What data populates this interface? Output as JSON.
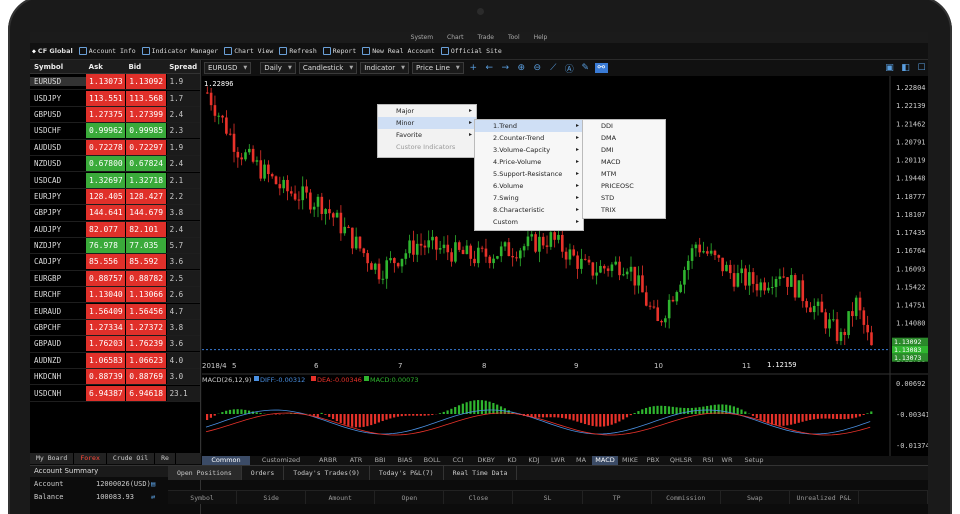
{
  "app": {
    "logo": "CF Global",
    "menu": [
      "System",
      "Chart",
      "Trade",
      "Tool",
      "Help"
    ]
  },
  "toolbar": [
    "Account Info",
    "Indicator Manager",
    "Chart View",
    "Refresh",
    "Report",
    "New Real Account",
    "Official Site"
  ],
  "watchlist": {
    "headers": [
      "Symbol",
      "Ask",
      "Bid",
      "Spread"
    ],
    "rows": [
      {
        "symbol": "EURUSD",
        "ask": "1.13073",
        "bid": "1.13092",
        "spread": "1.9",
        "ask_color": "#e0302a",
        "bid_color": "#e0302a"
      },
      {
        "symbol": "USDJPY",
        "ask": "113.551",
        "bid": "113.568",
        "spread": "1.7",
        "ask_color": "#e0302a",
        "bid_color": "#e0302a"
      },
      {
        "symbol": "GBPUSD",
        "ask": "1.27375",
        "bid": "1.27399",
        "spread": "2.4",
        "ask_color": "#e0302a",
        "bid_color": "#e0302a"
      },
      {
        "symbol": "USDCHF",
        "ask": "0.99962",
        "bid": "0.99985",
        "spread": "2.3",
        "ask_color": "#3aaa3a",
        "bid_color": "#3aaa3a"
      },
      {
        "symbol": "AUDUSD",
        "ask": "0.72278",
        "bid": "0.72297",
        "spread": "1.9",
        "ask_color": "#e0302a",
        "bid_color": "#e0302a"
      },
      {
        "symbol": "NZDUSD",
        "ask": "0.67800",
        "bid": "0.67824",
        "spread": "2.4",
        "ask_color": "#3aaa3a",
        "bid_color": "#3aaa3a"
      },
      {
        "symbol": "USDCAD",
        "ask": "1.32697",
        "bid": "1.32718",
        "spread": "2.1",
        "ask_color": "#3aaa3a",
        "bid_color": "#3aaa3a"
      },
      {
        "symbol": "EURJPY",
        "ask": "128.405",
        "bid": "128.427",
        "spread": "2.2",
        "ask_color": "#e0302a",
        "bid_color": "#e0302a"
      },
      {
        "symbol": "GBPJPY",
        "ask": "144.641",
        "bid": "144.679",
        "spread": "3.8",
        "ask_color": "#e0302a",
        "bid_color": "#e0302a"
      },
      {
        "symbol": "AUDJPY",
        "ask": "82.077",
        "bid": "82.101",
        "spread": "2.4",
        "ask_color": "#e0302a",
        "bid_color": "#e0302a"
      },
      {
        "symbol": "NZDJPY",
        "ask": "76.978",
        "bid": "77.035",
        "spread": "5.7",
        "ask_color": "#3aaa3a",
        "bid_color": "#3aaa3a"
      },
      {
        "symbol": "CADJPY",
        "ask": "85.556",
        "bid": "85.592",
        "spread": "3.6",
        "ask_color": "#e0302a",
        "bid_color": "#e0302a"
      },
      {
        "symbol": "EURGBP",
        "ask": "0.88757",
        "bid": "0.88782",
        "spread": "2.5",
        "ask_color": "#e0302a",
        "bid_color": "#e0302a"
      },
      {
        "symbol": "EURCHF",
        "ask": "1.13040",
        "bid": "1.13066",
        "spread": "2.6",
        "ask_color": "#e0302a",
        "bid_color": "#e0302a"
      },
      {
        "symbol": "EURAUD",
        "ask": "1.56409",
        "bid": "1.56456",
        "spread": "4.7",
        "ask_color": "#e0302a",
        "bid_color": "#e0302a"
      },
      {
        "symbol": "GBPCHF",
        "ask": "1.27334",
        "bid": "1.27372",
        "spread": "3.8",
        "ask_color": "#e0302a",
        "bid_color": "#e0302a"
      },
      {
        "symbol": "GBPAUD",
        "ask": "1.76203",
        "bid": "1.76239",
        "spread": "3.6",
        "ask_color": "#e0302a",
        "bid_color": "#e0302a"
      },
      {
        "symbol": "AUDNZD",
        "ask": "1.06583",
        "bid": "1.06623",
        "spread": "4.0",
        "ask_color": "#e0302a",
        "bid_color": "#e0302a"
      },
      {
        "symbol": "HKDCNH",
        "ask": "0.88739",
        "bid": "0.88769",
        "spread": "3.0",
        "ask_color": "#e0302a",
        "bid_color": "#e0302a"
      },
      {
        "symbol": "USDCNH",
        "ask": "6.94387",
        "bid": "6.94618",
        "spread": "23.1",
        "ask_color": "#e0302a",
        "bid_color": "#e0302a"
      }
    ],
    "tabs": [
      "My Board",
      "Forex",
      "Crude Oil",
      "Re"
    ]
  },
  "chart_toolbar": {
    "symbol": "EURUSD",
    "period": "Daily",
    "style": "Candlestick",
    "indicator": "Indicator",
    "line": "Price Line"
  },
  "menus": {
    "level1": [
      "Major",
      "Minor",
      "Favorite",
      "Custore Indicators"
    ],
    "level2": [
      "1.Trend",
      "2.Counter-Trend",
      "3.Volume-Capcity",
      "4.Price-Volume",
      "5.Support-Resistance",
      "6.Volume",
      "7.Swing",
      "8.Characteristic",
      "Custom"
    ],
    "level3": [
      "DDI",
      "DMA",
      "DMI",
      "MACD",
      "MTM",
      "PRICEOSC",
      "STD",
      "TRIX"
    ]
  },
  "chart_data": {
    "type": "candlestick",
    "symbol": "EURUSD",
    "ylim": [
      1.12738,
      1.22804
    ],
    "yticks": [
      "1.22804",
      "1.22139",
      "1.21462",
      "1.20791",
      "1.20119",
      "1.19448",
      "1.18777",
      "1.18107",
      "1.17435",
      "1.16764",
      "1.16093",
      "1.15422",
      "1.14751",
      "1.14080",
      "1.13409",
      "1.12738"
    ],
    "xticks": [
      "2018/4",
      "5",
      "6",
      "7",
      "8",
      "9",
      "10",
      "11"
    ],
    "labels": {
      "top": "1.22896",
      "low": "1.12159",
      "price1": "1.13092",
      "price2": "1.13083",
      "price3": "1.13073"
    },
    "macd": {
      "title": "MACD(26,12,9)",
      "diff": "DIFF:-0.00312",
      "dea": "DEA:-0.00346",
      "macd": "MACD:0.00073",
      "yticks": [
        "0.00692",
        "-0.00341",
        "-0.01374"
      ]
    }
  },
  "chart_tabs": [
    "Common",
    "Customized",
    "ARBR",
    "ATR",
    "BBI",
    "BIAS",
    "BOLL",
    "CCI",
    "DKBY",
    "KD",
    "KDJ",
    "LWR",
    "MA",
    "MACD",
    "MIKE",
    "PBX",
    "QHLSR",
    "RSI",
    "WR",
    "Setup"
  ],
  "account": {
    "title": "Account Summary",
    "rows": [
      {
        "k": "Account",
        "v": "12000026(USD)"
      },
      {
        "k": "Balance",
        "v": "100083.93"
      }
    ]
  },
  "positions": {
    "tabs": [
      "Open Positions",
      "Orders",
      "Today's Trades(9)",
      "Today's P&L(7)",
      "Real Time Data"
    ],
    "cols": [
      "Symbol",
      "Side",
      "Amount",
      "Open",
      "Close",
      "SL",
      "TP",
      "Commission",
      "Swap",
      "Unrealized P&L",
      ""
    ]
  }
}
